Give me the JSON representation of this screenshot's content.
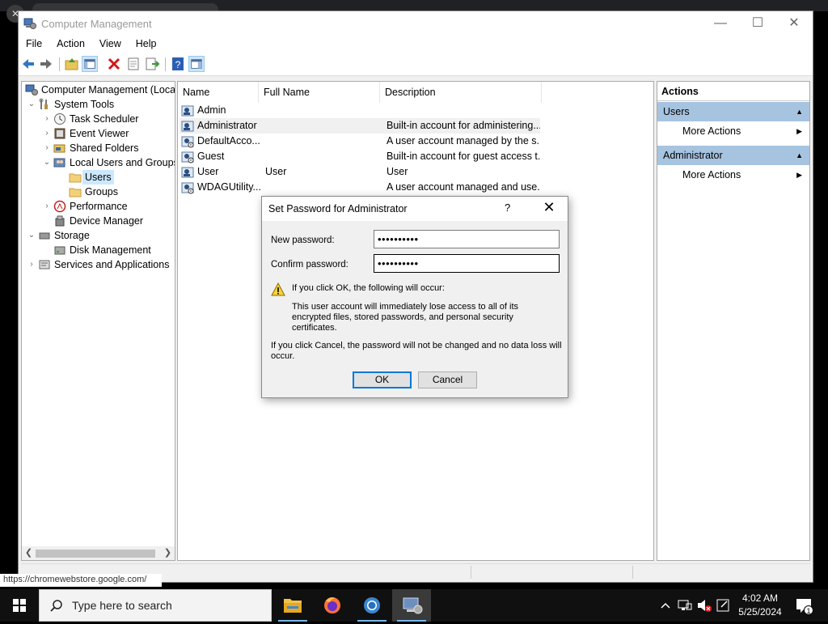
{
  "window": {
    "title": "Computer Management",
    "controls": {
      "minimize": "—",
      "maximize": "☐",
      "close": "✕"
    }
  },
  "menu": [
    "File",
    "Action",
    "View",
    "Help"
  ],
  "tree": {
    "items": [
      {
        "label": "Computer Management (Local",
        "icon": "computer-management-icon",
        "arrow": ""
      },
      {
        "label": "System Tools",
        "icon": "tools-icon",
        "arrow": "⌄"
      },
      {
        "label": "Task Scheduler",
        "icon": "clock-icon",
        "arrow": "›"
      },
      {
        "label": "Event Viewer",
        "icon": "event-viewer-icon",
        "arrow": "›"
      },
      {
        "label": "Shared Folders",
        "icon": "shared-folder-icon",
        "arrow": "›"
      },
      {
        "label": "Local Users and Groups",
        "icon": "users-groups-icon",
        "arrow": "⌄"
      },
      {
        "label": "Users",
        "icon": "folder-icon",
        "arrow": ""
      },
      {
        "label": "Groups",
        "icon": "folder-icon",
        "arrow": ""
      },
      {
        "label": "Performance",
        "icon": "performance-icon",
        "arrow": "›"
      },
      {
        "label": "Device Manager",
        "icon": "device-manager-icon",
        "arrow": ""
      },
      {
        "label": "Storage",
        "icon": "storage-icon",
        "arrow": "⌄"
      },
      {
        "label": "Disk Management",
        "icon": "disk-icon",
        "arrow": ""
      },
      {
        "label": "Services and Applications",
        "icon": "services-icon",
        "arrow": "›"
      }
    ]
  },
  "list": {
    "columns": [
      "Name",
      "Full Name",
      "Description"
    ],
    "rows": [
      {
        "name": "Admin",
        "full_name": "",
        "description": ""
      },
      {
        "name": "Administrator",
        "full_name": "",
        "description": "Built-in account for administering..."
      },
      {
        "name": "DefaultAcco...",
        "full_name": "",
        "description": "A user account managed by the s..."
      },
      {
        "name": "Guest",
        "full_name": "",
        "description": "Built-in account for guest access t..."
      },
      {
        "name": "User",
        "full_name": "User",
        "description": "User"
      },
      {
        "name": "WDAGUtility...",
        "full_name": "",
        "description": "A user account managed and use..."
      }
    ]
  },
  "actions": {
    "heading": "Actions",
    "sections": [
      {
        "title": "Users",
        "item": "More Actions"
      },
      {
        "title": "Administrator",
        "item": "More Actions"
      }
    ]
  },
  "status_url": "https://chromewebstore.google.com/",
  "dialog": {
    "title": "Set Password for Administrator",
    "help": "?",
    "close": "✕",
    "new_password_label": "New password:",
    "new_password_value": "••••••••••",
    "confirm_password_label": "Confirm password:",
    "confirm_password_value": "••••••••••",
    "warning_heading": "If you click OK, the following will occur:",
    "warning_body": "This user account will immediately lose access to all of its encrypted files, stored passwords, and personal security certificates.",
    "cancel_note": "If you click Cancel, the password will not be changed and no data loss will occur.",
    "ok_label": "OK",
    "cancel_label": "Cancel"
  },
  "taskbar": {
    "search_placeholder": "Type here to search",
    "time": "4:02 AM",
    "date": "5/25/2024",
    "notification_count": "1"
  }
}
